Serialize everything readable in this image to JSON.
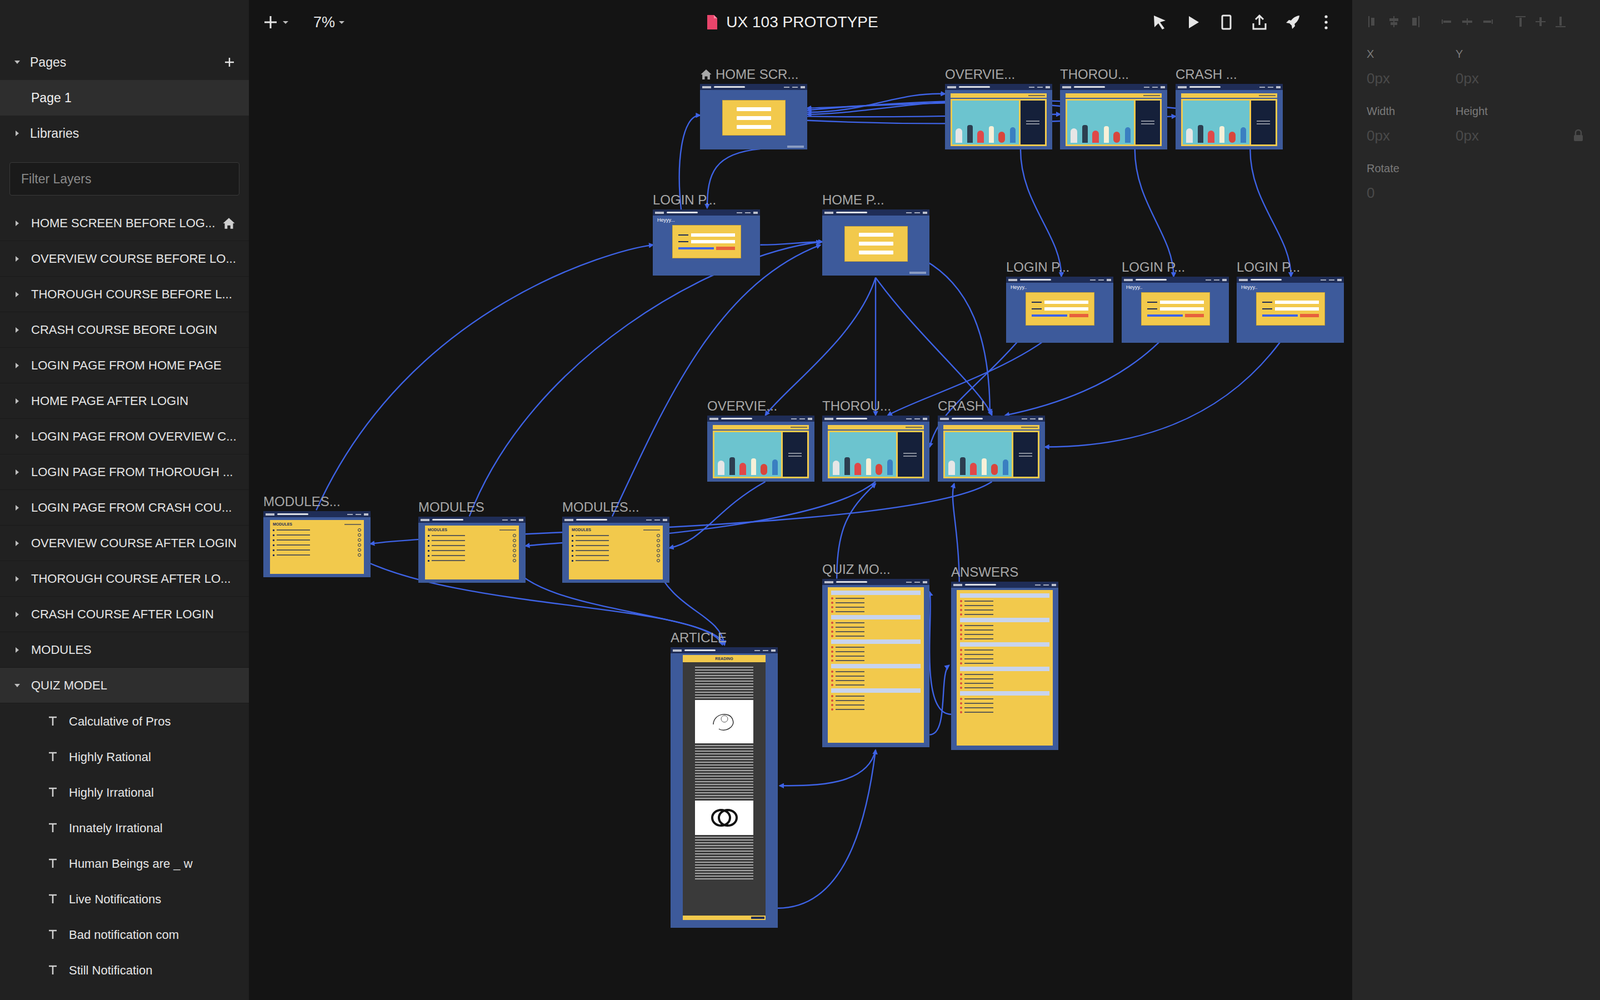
{
  "toolbar": {
    "zoom": "7%",
    "title": "UX 103 PROTOTYPE"
  },
  "sidebar": {
    "pages_label": "Pages",
    "pages_expanded": true,
    "pages": [
      {
        "label": "Page 1",
        "selected": true
      }
    ],
    "libraries": {
      "label": "Libraries",
      "expanded": false
    },
    "filter_placeholder": "Filter Layers",
    "layers": [
      {
        "label": "HOME SCREEN BEFORE LOG...",
        "home": true,
        "expanded": false,
        "selected": false
      },
      {
        "label": "OVERVIEW COURSE BEFORE LO...",
        "home": false,
        "expanded": false,
        "selected": false
      },
      {
        "label": "THOROUGH COURSE BEFORE L...",
        "home": false,
        "expanded": false,
        "selected": false
      },
      {
        "label": "CRASH COURSE BEORE LOGIN",
        "home": false,
        "expanded": false,
        "selected": false
      },
      {
        "label": "LOGIN PAGE FROM HOME PAGE",
        "home": false,
        "expanded": false,
        "selected": false
      },
      {
        "label": "HOME PAGE AFTER LOGIN",
        "home": false,
        "expanded": false,
        "selected": false
      },
      {
        "label": "LOGIN PAGE FROM OVERVIEW C...",
        "home": false,
        "expanded": false,
        "selected": false
      },
      {
        "label": "LOGIN PAGE FROM THOROUGH ...",
        "home": false,
        "expanded": false,
        "selected": false
      },
      {
        "label": "LOGIN PAGE FROM CRASH COU...",
        "home": false,
        "expanded": false,
        "selected": false
      },
      {
        "label": "OVERVIEW COURSE AFTER LOGIN",
        "home": false,
        "expanded": false,
        "selected": false
      },
      {
        "label": "THOROUGH COURSE AFTER LO...",
        "home": false,
        "expanded": false,
        "selected": false
      },
      {
        "label": "CRASH COURSE AFTER LOGIN",
        "home": false,
        "expanded": false,
        "selected": false
      },
      {
        "label": "MODULES",
        "home": false,
        "expanded": false,
        "selected": false
      },
      {
        "label": "QUIZ MODEL",
        "home": false,
        "expanded": true,
        "selected": true,
        "children": [
          "Calculative of Pros",
          "Highly Rational",
          "Highly Irrational",
          "Innately Irrational",
          "Human Beings are _ w",
          "Live Notifications",
          "Bad notification com",
          "Still Notification"
        ]
      }
    ]
  },
  "inspector": {
    "x": {
      "label": "X",
      "value": "0px"
    },
    "y": {
      "label": "Y",
      "value": "0px"
    },
    "width": {
      "label": "Width",
      "value": "0px"
    },
    "height": {
      "label": "Height",
      "value": "0px"
    },
    "rotate": {
      "label": "Rotate",
      "value": "0"
    }
  },
  "artboards": [
    {
      "label": "HOME SCR...",
      "kind": "home",
      "home": true
    },
    {
      "label": "OVERVIE...",
      "kind": "course",
      "home": false
    },
    {
      "label": "THOROU...",
      "kind": "course",
      "home": false
    },
    {
      "label": "CRASH ...",
      "kind": "course",
      "home": false
    },
    {
      "label": "LOGIN P...",
      "kind": "login",
      "home": false,
      "greeting": "Heyyy..."
    },
    {
      "label": "HOME P...",
      "kind": "home",
      "home": false
    },
    {
      "label": "LOGIN P...",
      "kind": "login",
      "home": false,
      "greeting": "Heyyy.."
    },
    {
      "label": "LOGIN P...",
      "kind": "login",
      "home": false,
      "greeting": "Heyyy.."
    },
    {
      "label": "LOGIN P...",
      "kind": "login",
      "home": false,
      "greeting": "Heyyy.."
    },
    {
      "label": "OVERVIE...",
      "kind": "course",
      "home": false
    },
    {
      "label": "THOROU...",
      "kind": "course",
      "home": false
    },
    {
      "label": "CRASH",
      "kind": "course",
      "home": false
    },
    {
      "label": "MODULES...",
      "kind": "modules",
      "home": false,
      "heading": "MODULES"
    },
    {
      "label": "MODULES",
      "kind": "modules",
      "home": false,
      "heading": "MODULES"
    },
    {
      "label": "MODULES...",
      "kind": "modules",
      "home": false,
      "heading": "MODULES"
    },
    {
      "label": "ARTICLE",
      "kind": "article",
      "home": false,
      "heading": "READING"
    },
    {
      "label": "QUIZ MO...",
      "kind": "quiz",
      "home": false
    },
    {
      "label": "ANSWERS",
      "kind": "quiz",
      "home": false
    }
  ]
}
